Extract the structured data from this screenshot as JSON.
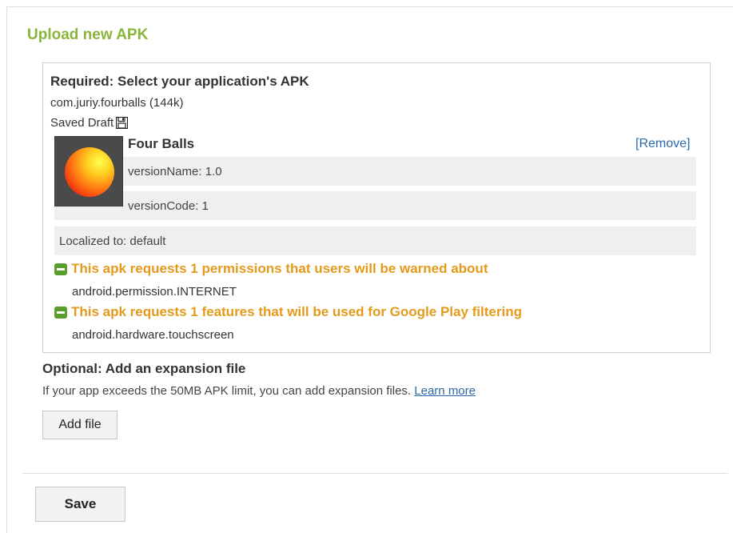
{
  "dialog": {
    "title": "Upload new APK"
  },
  "apk": {
    "required_heading": "Required: Select your application's APK",
    "package": "com.juriy.fourballs (144k)",
    "status": "Saved Draft",
    "status_icon": "save-disk-icon",
    "app_name": "Four Balls",
    "remove_label": "[Remove]",
    "version_name": "versionName: 1.0",
    "version_code": "versionCode: 1",
    "localized": "Localized to: default",
    "permissions_warning": "This apk requests 1 permissions that users will be warned about",
    "permissions": [
      "android.permission.INTERNET"
    ],
    "features_warning": "This apk requests 1 features that will be used for Google Play filtering",
    "features": [
      "android.hardware.touchscreen"
    ]
  },
  "expansion": {
    "heading": "Optional: Add an expansion file",
    "description": "If your app exceeds the 50MB APK limit, you can add expansion files.",
    "learn_more": "Learn more",
    "add_file_label": "Add file"
  },
  "footer": {
    "save_label": "Save"
  },
  "colors": {
    "title_green": "#8ab53b",
    "warning_orange": "#e59a1c",
    "link_blue": "#2a6aa8",
    "collapse_green": "#5a9e2e",
    "row_gray": "#efefef"
  }
}
